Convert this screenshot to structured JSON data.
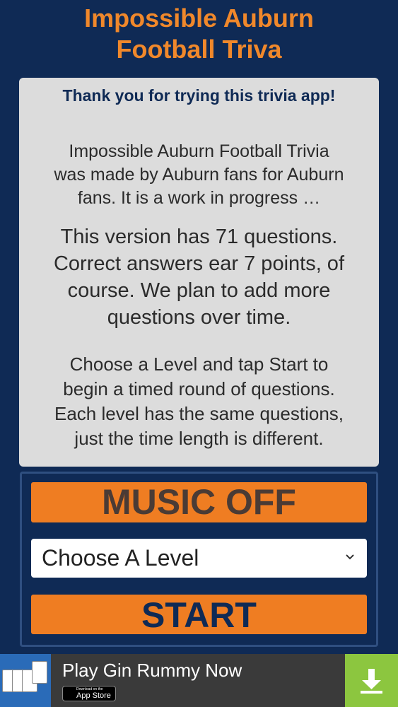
{
  "header": {
    "title_line1": "Impossible Auburn",
    "title_line2": "Football Triva"
  },
  "info": {
    "heading": "Thank you for trying this trivia app!",
    "paragraph1": [
      "Impossible Auburn Football Trivia",
      "was made by Auburn fans for Auburn",
      "fans. It is a work in progress …"
    ],
    "paragraph2": [
      "This version has 71 questions.",
      "Correct answers ear 7 points, of",
      "course. We plan to add more",
      "questions over time."
    ],
    "paragraph3": [
      "Choose a Level and tap Start to",
      "begin a timed round of questions.",
      "Each level has the same questions,",
      "just the time length is different."
    ]
  },
  "controls": {
    "music_label": "MUSIC OFF",
    "level_selected": "Choose A Level",
    "start_label": "START"
  },
  "ad": {
    "title": "Play Gin Rummy Now",
    "appstore_small": "Download on the",
    "appstore_big": "App Store",
    "icon": "download-icon"
  },
  "colors": {
    "background": "#0f2a55",
    "accent_orange": "#ef7d22",
    "panel": "#dcdcdc",
    "ad_green": "#8cc63f"
  }
}
